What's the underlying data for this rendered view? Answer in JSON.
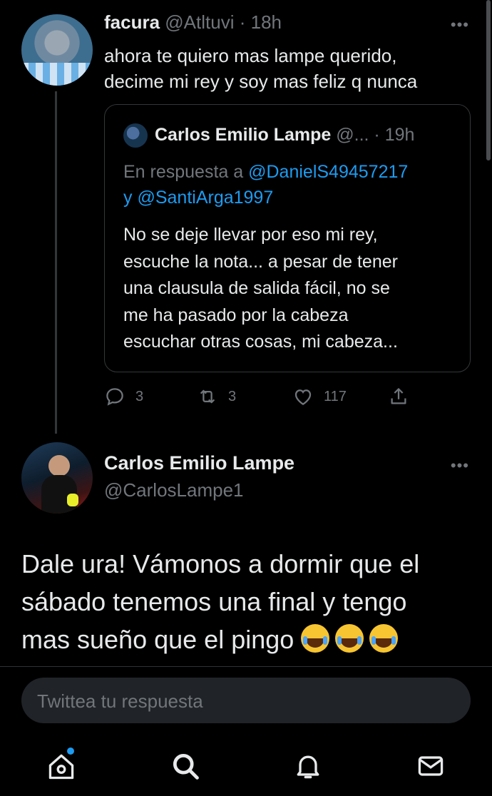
{
  "tweet1": {
    "name": "facura",
    "handle": "@Atltuvi",
    "sep": "·",
    "time": "18h",
    "more": "•••",
    "text_line1": "ahora te quiero mas lampe querido,",
    "text_line2": "decime mi rey y soy mas feliz q nunca",
    "quote": {
      "name": "Carlos Emilio Lampe",
      "handle": "@...",
      "sep": "·",
      "time": "19h",
      "reply_prefix": "En respuesta a",
      "reply_user1": "@DanielS49457217",
      "reply_conj": "y",
      "reply_user2": "@SantiArga1997",
      "lines": [
        "No se deje llevar por eso mi rey,",
        "escuche la nota... a pesar de tener",
        "una clausula de salida fácil, no se",
        "me ha pasado por la cabeza",
        "escuchar otras cosas, mi cabeza..."
      ]
    },
    "actions": {
      "replies": "3",
      "retweets": "3",
      "likes": "117"
    }
  },
  "tweet2": {
    "name": "Carlos Emilio Lampe",
    "handle": "@CarlosLampe1",
    "more": "•••",
    "lines": [
      "Dale ura! Vámonos a dormir que el",
      "sábado tenemos una final y tengo",
      "mas sueño que el pingo"
    ],
    "emoji": "face-with-tears-of-joy x3"
  },
  "reply": {
    "placeholder": "Twittea tu respuesta"
  },
  "nav": [
    "home-icon",
    "search-icon",
    "notifications-icon",
    "messages-icon"
  ],
  "colors": {
    "background": "#000000",
    "text": "#e7e9ea",
    "muted": "#71767b",
    "accent": "#1d9bf0",
    "border": "#333639"
  }
}
